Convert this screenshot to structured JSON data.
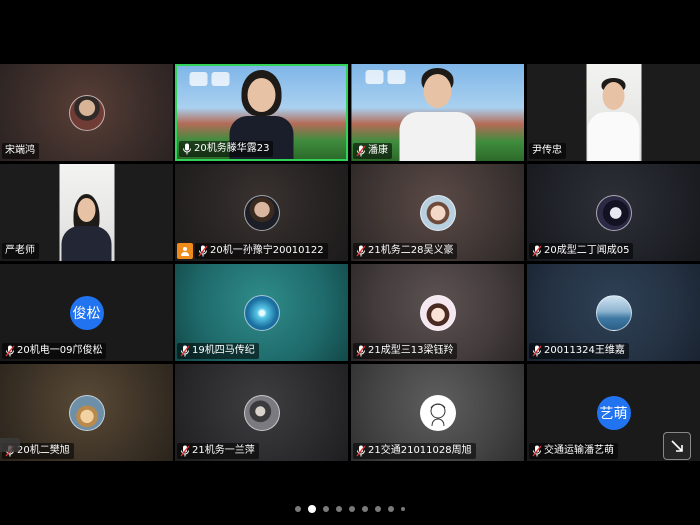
{
  "pagination": {
    "pages": 9,
    "current": 2
  },
  "colors": {
    "active_speaker_border": "#32d25a",
    "avatar_blue": "#2173f0",
    "raise_hand_orange": "#ef8a1c",
    "mic_red": "#e03030"
  },
  "participants": [
    {
      "name": "宋端鸿"
    },
    {
      "name": "20机务滕华露23"
    },
    {
      "name": "潘康"
    },
    {
      "name": "尹传忠"
    },
    {
      "name": "严老师"
    },
    {
      "name": "20机一孙豫宁20010122"
    },
    {
      "name": "21机务二28吴义豪"
    },
    {
      "name": "20成型二丁闻成05"
    },
    {
      "name": "20机电一09邝俊松",
      "avatar_text": "俊松"
    },
    {
      "name": "19机四马传纪"
    },
    {
      "name": "21成型三13梁钰羚"
    },
    {
      "name": "20011324王维嘉"
    },
    {
      "name": "20机二樊旭"
    },
    {
      "name": "21机务一兰萍"
    },
    {
      "name": "21交通21011028周旭"
    },
    {
      "name": "交通运输潘艺萌",
      "avatar_text": "艺萌"
    }
  ]
}
